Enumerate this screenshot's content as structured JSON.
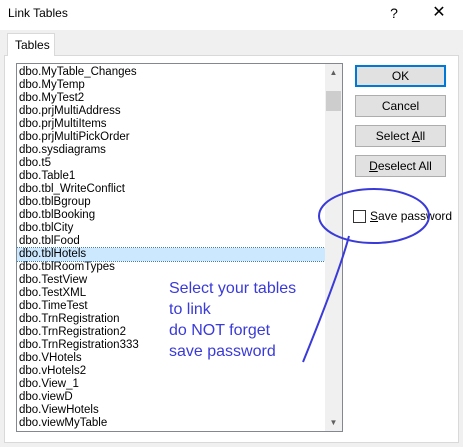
{
  "window": {
    "title": "Link Tables",
    "help_glyph": "?",
    "close_glyph": "✕"
  },
  "tabs": [
    {
      "label": "Tables"
    }
  ],
  "tables": [
    "dbo.MyTable_Changes",
    "dbo.MyTemp",
    "dbo.MyTest2",
    "dbo.prjMultiAddress",
    "dbo.prjMultiItems",
    "dbo.prjMultiPickOrder",
    "dbo.sysdiagrams",
    "dbo.t5",
    "dbo.Table1",
    "dbo.tbl_WriteConflict",
    "dbo.tblBgroup",
    "dbo.tblBooking",
    "dbo.tblCity",
    "dbo.tblFood",
    "dbo.tblHotels",
    "dbo.tblRoomTypes",
    "dbo.TestView",
    "dbo.TestXML",
    "dbo.TimeTest",
    "dbo.TrnRegistration",
    "dbo.TrnRegistration2",
    "dbo.TrnRegistration333",
    "dbo.VHotels",
    "dbo.vHotels2",
    "dbo.View_1",
    "dbo.viewD",
    "dbo.ViewHotels",
    "dbo.viewMyTable"
  ],
  "selected_table": "dbo.tblHotels",
  "buttons": {
    "ok": "OK",
    "cancel": "Cancel",
    "select_all_prefix": "Select ",
    "select_all_hotkey": "A",
    "select_all_suffix": "ll",
    "deselect_all_hotkey": "D",
    "deselect_all_suffix": "eselect All"
  },
  "save_password": {
    "hotkey": "S",
    "label_rest": "ave password",
    "checked": false
  },
  "annotation": {
    "lines": [
      "Select your tables",
      "to link",
      "do NOT forget",
      "save password"
    ],
    "color": "#3a3ad9"
  },
  "colors": {
    "selection": "#cce8ff",
    "default_button_border": "#0078d7"
  }
}
